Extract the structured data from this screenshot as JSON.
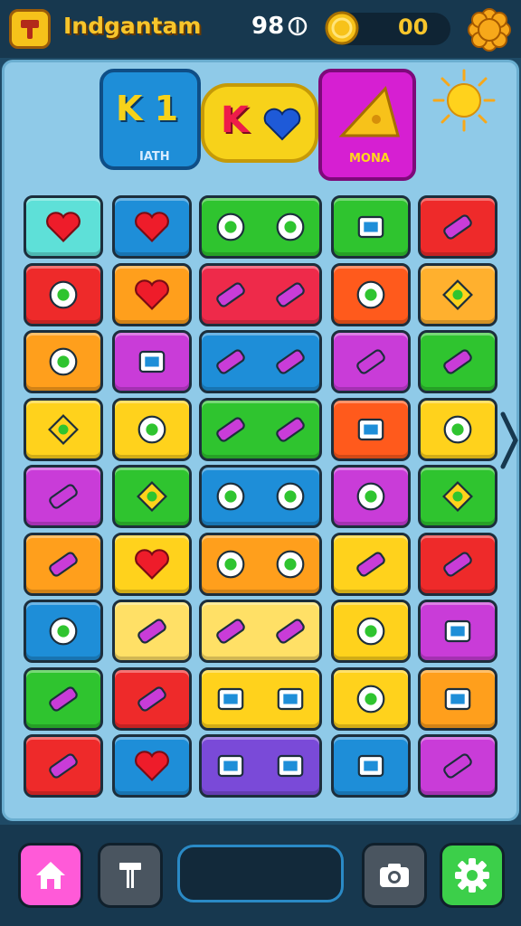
{
  "header": {
    "app_title": "Indgantam",
    "count_value": "98",
    "coin_value": "00",
    "icons": {
      "logo": "hammer-badge-icon",
      "count": "currency-icon",
      "coin": "gold-coin-icon",
      "settings": "flower-gear-icon"
    }
  },
  "banners": {
    "left_big": "K 1",
    "left_small": "IATH",
    "middle_big": "K",
    "right_small": "MONA"
  },
  "colors": {
    "board_bg": "#8fcae8",
    "topbar_bg": "#17384f",
    "accent_yellow": "#f7c52b"
  },
  "tiles": [
    {
      "color": "#5ee0d8",
      "icon": "heart-icon"
    },
    {
      "color": "#1e8ed8",
      "icon": "heart-icon"
    },
    {
      "color": "#2fc42f",
      "icon": "pot-face-icon",
      "wide": true
    },
    {
      "color": "#2fc42f",
      "icon": "gift-box-icon"
    },
    {
      "color": "#ee2a2a",
      "icon": "key-icon"
    },
    {
      "color": "#ee2a2a",
      "icon": "gear-coin-icon"
    },
    {
      "color": "#ff9f1c",
      "icon": "heart-icon"
    },
    {
      "color": "#ee2a4a",
      "icon": "pencil-blob-icon",
      "wide": true
    },
    {
      "color": "#ff5a1c",
      "icon": "cloud-icon"
    },
    {
      "color": "#ffb02e",
      "icon": "plus-shape-icon"
    },
    {
      "color": "#ff9f1c",
      "icon": "bike-icon"
    },
    {
      "color": "#c93cd8",
      "icon": "bag-icon"
    },
    {
      "color": "#1e8ed8",
      "icon": "spoon-pencil-icon",
      "wide": true
    },
    {
      "color": "#c93cd8",
      "icon": "battery-icon"
    },
    {
      "color": "#2fc42f",
      "icon": "battery-icon"
    },
    {
      "color": "#ffd21c",
      "icon": "gem-icon"
    },
    {
      "color": "#ffd21c",
      "icon": "egg-icon"
    },
    {
      "color": "#2fc42f",
      "icon": "pencils-icon",
      "wide": true
    },
    {
      "color": "#ff5a1c",
      "icon": "camera-icon"
    },
    {
      "color": "#ffd21c",
      "icon": "blob-icon"
    },
    {
      "color": "#c93cd8",
      "icon": "key-note-icon"
    },
    {
      "color": "#2fc42f",
      "icon": "cheese-icon"
    },
    {
      "color": "#1e8ed8",
      "icon": "horseshoe-leaf-icon",
      "wide": true
    },
    {
      "color": "#c93cd8",
      "icon": "cookie-icon"
    },
    {
      "color": "#2fc42f",
      "icon": "diamond-icon"
    },
    {
      "color": "#ff9f1c",
      "icon": "torch-icon"
    },
    {
      "color": "#ffd21c",
      "icon": "heart-icon"
    },
    {
      "color": "#ff9f1c",
      "icon": "pot-ring-icon",
      "wide": true
    },
    {
      "color": "#ffd21c",
      "icon": "crayon-icon"
    },
    {
      "color": "#ee2a2a",
      "icon": "crayon-icon"
    },
    {
      "color": "#1e8ed8",
      "icon": "cherries-icon"
    },
    {
      "color": "#ffe066",
      "icon": "roll-icon"
    },
    {
      "color": "#ffe066",
      "icon": "brush-gear-icon",
      "wide": true
    },
    {
      "color": "#ffd21c",
      "icon": "frog-icon"
    },
    {
      "color": "#c93cd8",
      "icon": "check-card-icon"
    },
    {
      "color": "#2fc42f",
      "icon": "marker-icon"
    },
    {
      "color": "#ee2a2a",
      "icon": "marker-icon"
    },
    {
      "color": "#ffd21c",
      "icon": "gem-card-icon",
      "wide": true
    },
    {
      "color": "#ffd21c",
      "icon": "ring-cloud-icon"
    },
    {
      "color": "#ff9f1c",
      "icon": "bag-icon"
    },
    {
      "color": "#ee2a2a",
      "icon": "crayon-icon"
    },
    {
      "color": "#1e8ed8",
      "icon": "heart-icon"
    },
    {
      "color": "#7a4ad8",
      "icon": "camera-icon",
      "wide": true
    },
    {
      "color": "#1e8ed8",
      "icon": "check-card-icon"
    },
    {
      "color": "#c93cd8",
      "icon": "rattle-icon"
    }
  ],
  "bottom_nav": [
    {
      "name": "home",
      "icon": "home-icon",
      "color": "#ff5ad8"
    },
    {
      "name": "tool",
      "icon": "hammer-icon",
      "color": "#4a5560"
    },
    {
      "name": "camera",
      "icon": "camera-icon",
      "color": "#4a5560"
    },
    {
      "name": "settings",
      "icon": "gear-icon",
      "color": "#3ccf4a"
    }
  ]
}
